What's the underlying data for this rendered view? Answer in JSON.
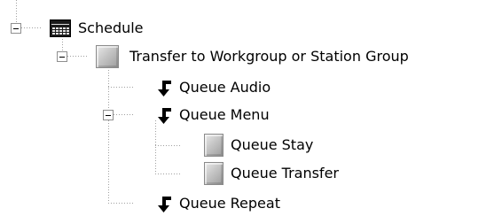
{
  "tree": {
    "root": {
      "label": "Schedule",
      "icon": "calendar-icon",
      "expanded": true
    },
    "transfer": {
      "label": "Transfer to Workgroup or Station Group",
      "icon": "gray-box-icon",
      "expanded": true
    },
    "queue_audio": {
      "label": "Queue Audio",
      "icon": "queue-arrow-icon"
    },
    "queue_menu": {
      "label": "Queue Menu",
      "icon": "queue-arrow-icon",
      "expanded": true
    },
    "queue_stay": {
      "label": "Queue Stay",
      "icon": "gray-box-icon"
    },
    "queue_transfer": {
      "label": "Queue Transfer",
      "icon": "gray-box-icon"
    },
    "queue_repeat": {
      "label": "Queue Repeat",
      "icon": "queue-arrow-icon"
    }
  },
  "colors": {
    "connector": "#a0a0a0",
    "text": "#000000",
    "expander_border": "#8f8f8f"
  }
}
